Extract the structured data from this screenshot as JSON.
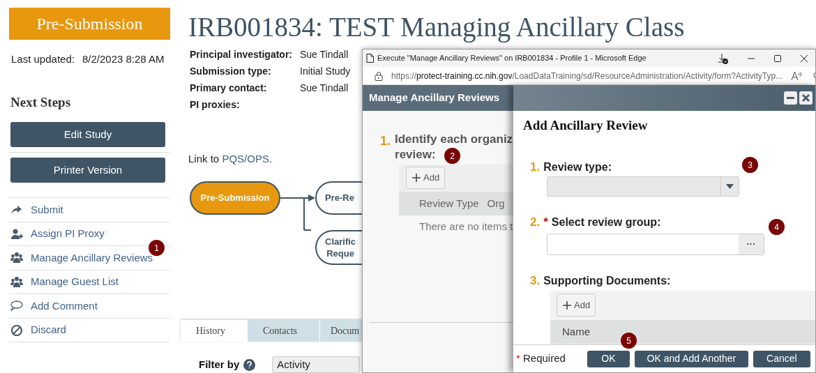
{
  "sidebar": {
    "state_badge": "Pre-Submission",
    "last_updated": {
      "label": "Last updated:",
      "value": "8/2/2023 8:28 AM"
    },
    "heading": "Next Steps",
    "buttons": [
      "Edit Study",
      "Printer Version"
    ],
    "actions": [
      {
        "label": "Submit",
        "kind": "share"
      },
      {
        "label": "Assign PI Proxy",
        "kind": "user-add"
      },
      {
        "label": "Manage Ancillary Reviews",
        "kind": "group"
      },
      {
        "label": "Manage Guest List",
        "kind": "group"
      },
      {
        "label": "Add Comment",
        "kind": "comment"
      },
      {
        "label": "Discard",
        "kind": "ban"
      }
    ]
  },
  "main": {
    "title": "IRB001834: TEST Managing Ancillary Class",
    "details": [
      {
        "label": "Principal investigator:",
        "value": "Sue Tindall"
      },
      {
        "label": "Submission type:",
        "value": "Initial Study"
      },
      {
        "label": "Primary contact:",
        "value": "Sue Tindall"
      },
      {
        "label": "PI proxies:"
      }
    ],
    "link_line": {
      "before": "Link to ",
      "link": "PQS/OPS",
      "after": "."
    },
    "workflow": [
      {
        "label": "Pre-Submission",
        "current": true
      },
      {
        "label": "Pre-Re",
        "current": false
      },
      {
        "label": "Clarific\nReque",
        "current": false
      }
    ],
    "tabs": [
      {
        "label": "History",
        "selected": true
      },
      {
        "label": "Contacts",
        "selected": false
      },
      {
        "label": "Docum",
        "selected": false
      }
    ],
    "filter": {
      "label": "Filter by",
      "value": "Activity"
    }
  },
  "browser_window": {
    "title": "Execute \"Manage Ancillary Reviews\" on IRB001834 - Profile 1 - Microsoft Edge",
    "url": {
      "scheme": "https://",
      "host": "protect-training.cc.nih.gov",
      "path": "/LoadDataTraining/sd/ResourceAdministration/Activity/form?ActivityTyp..."
    },
    "panel": {
      "title": "Manage Ancillary Reviews",
      "question": {
        "number": "1.",
        "text_lines": [
          "Identify each organiz",
          "review:"
        ]
      },
      "add_button": "Add",
      "columns": [
        "Review Type",
        "Org"
      ],
      "empty_message": "There are no items t"
    },
    "dialog": {
      "title": "Add Ancillary Review",
      "questions": [
        {
          "number": "1.",
          "label": "Review type:",
          "kind": "select"
        },
        {
          "number": "2.",
          "label": "Select review group:",
          "kind": "chooser",
          "required_mark": "*",
          "chooser_button": "···"
        },
        {
          "number": "3.",
          "label": "Supporting Documents:",
          "kind": "documents",
          "add_button": "Add",
          "columns": [
            "Name"
          ]
        }
      ],
      "required_note": {
        "mark": "*",
        "text": "Required"
      },
      "buttons": [
        "OK",
        "OK and Add Another",
        "Cancel"
      ]
    }
  },
  "callouts": [
    "1",
    "2",
    "3",
    "4",
    "5"
  ]
}
